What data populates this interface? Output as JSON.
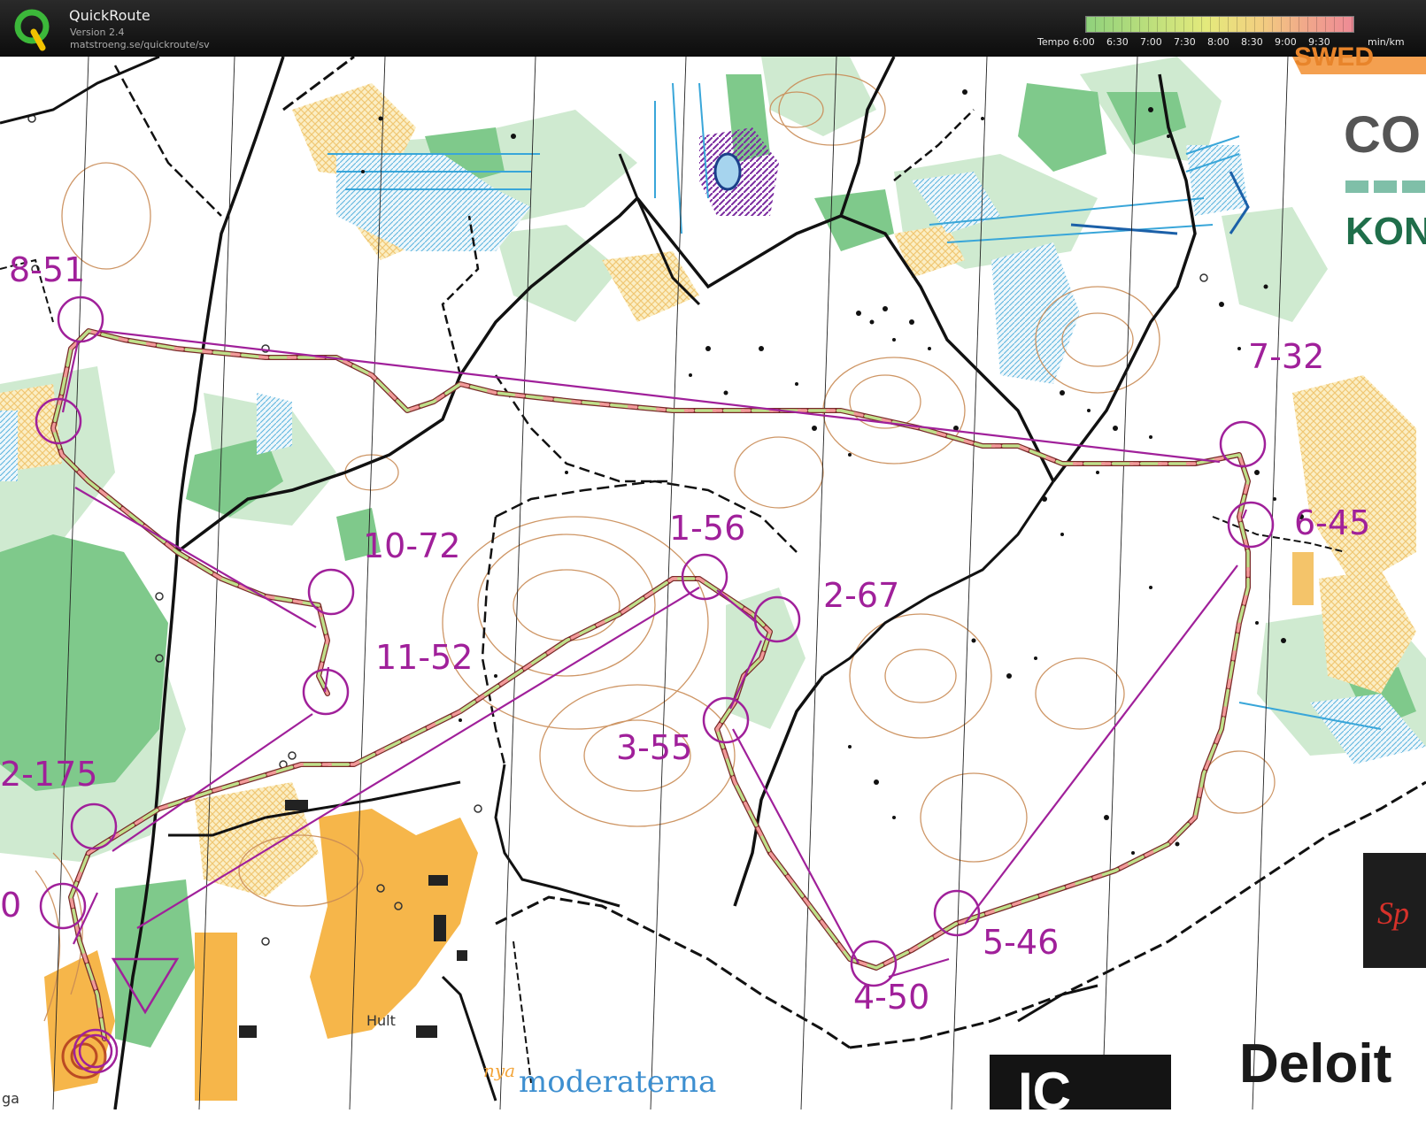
{
  "app": {
    "title": "QuickRoute",
    "version": "Version 2.4",
    "url": "matstroeng.se/quickroute/sv"
  },
  "legend": {
    "label": "Tempo",
    "ticks": [
      "6:00",
      "6:30",
      "7:00",
      "7:30",
      "8:00",
      "8:30",
      "9:00",
      "9:30"
    ],
    "unit": "min/km"
  },
  "controls": [
    {
      "id": "8",
      "label": "8-51"
    },
    {
      "id": "7",
      "label": "7-32"
    },
    {
      "id": "10",
      "label": "10-72"
    },
    {
      "id": "1",
      "label": "1-56"
    },
    {
      "id": "2",
      "label": "2-67"
    },
    {
      "id": "6",
      "label": "6-45"
    },
    {
      "id": "11",
      "label": "11-52"
    },
    {
      "id": "3",
      "label": "3-55"
    },
    {
      "id": "12",
      "label": "2-175"
    },
    {
      "id": "5",
      "label": "5-46"
    },
    {
      "id": "4",
      "label": "4-50"
    },
    {
      "id": "9",
      "label": "0"
    }
  ],
  "places": {
    "hult": "Hult",
    "corner": "ga"
  },
  "ads": {
    "moderaterna_small": "nya",
    "moderaterna": "moderaterna",
    "deloitte": "Deloit",
    "ko1": "CO",
    "ko2": "KON",
    "swed": "SWED",
    "sp": "Sp",
    "ic": "IC"
  },
  "colors": {
    "course": "#a0209a",
    "green": "#5fb870",
    "greenLight": "#c3e6bf",
    "yellow": "#f3d27a",
    "yellowHatch": "#f6e0a0",
    "brown": "#c97b3a",
    "blue": "#39a6d9",
    "road": "#111111"
  }
}
